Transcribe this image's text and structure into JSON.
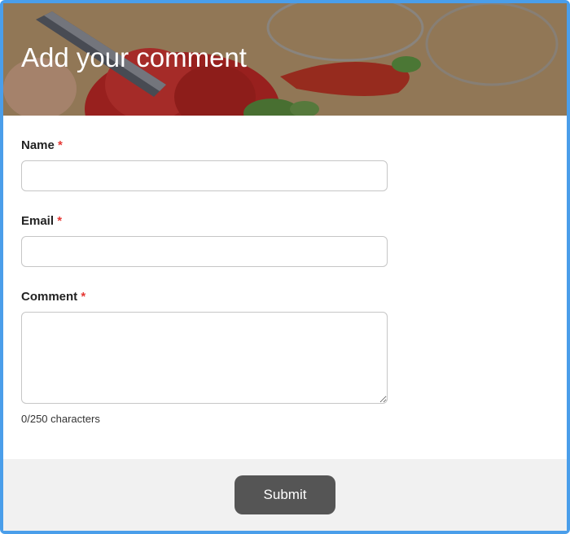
{
  "header": {
    "title": "Add your comment"
  },
  "fields": {
    "name": {
      "label": "Name",
      "required_mark": "*",
      "value": ""
    },
    "email": {
      "label": "Email",
      "required_mark": "*",
      "value": ""
    },
    "comment": {
      "label": "Comment",
      "required_mark": "*",
      "value": "",
      "counter": "0/250 characters"
    }
  },
  "footer": {
    "submit_label": "Submit"
  }
}
